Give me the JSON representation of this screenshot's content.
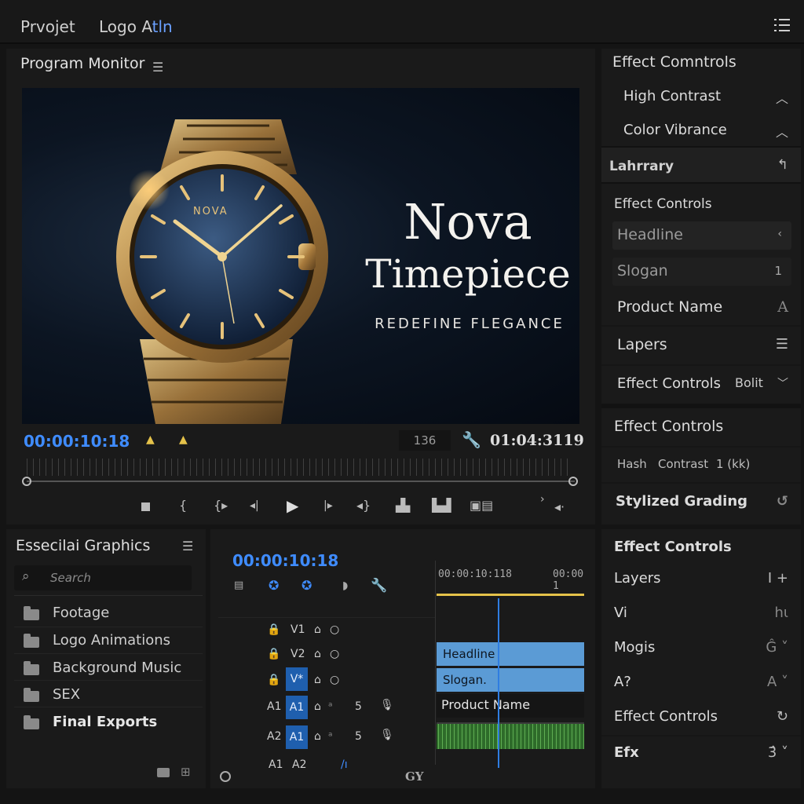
{
  "topbar": {
    "menu_1": "Prvojet",
    "menu_2_a": "Logo A",
    "menu_2_b": "tln"
  },
  "program": {
    "title": "Program Monitor",
    "viewer": {
      "headline_1": "Nova",
      "headline_2": "Timepiece",
      "tagline": "REDEFINE FLEGANCE",
      "dial_brand": "NOVA"
    },
    "timecode_left": "00:00:10:18",
    "zoom_value": "136",
    "timecode_right": "01:04:3119"
  },
  "effects_panel": {
    "header": "Effect Comntrols",
    "items": [
      "High Contrast",
      "Color Vibrance"
    ],
    "library_label": "Lahrrary",
    "section_label": "Effect Controls",
    "fields": [
      {
        "label": "Headline",
        "value": "‹"
      },
      {
        "label": "Slogan",
        "value": "1"
      },
      {
        "label": "Product Name",
        "value": "A"
      }
    ],
    "layers_label": "Lapers",
    "effect_controls_2": "Effect Controls",
    "effect_controls_2_value": "Bolit",
    "effect_controls_3": "Effect Controls",
    "hash_row": {
      "a": "Hash",
      "b": "Contrast",
      "c": "1 (kk)"
    },
    "stylized": "Stylized Grading"
  },
  "essential": {
    "title": "Essecilai Graphics",
    "search_placeholder": "Search",
    "folders": [
      "Footage",
      "Logo  Animations",
      "Background Music",
      "SEX",
      "Final Exports"
    ]
  },
  "timeline": {
    "timecode": "00:00:10:18",
    "ruler_1": "00:00:10:118",
    "ruler_2": "00:00 1",
    "tracks": [
      {
        "label": "V1"
      },
      {
        "label": "V2"
      },
      {
        "label": "V*"
      },
      {
        "src": "A1",
        "label": "A1",
        "num": "5"
      },
      {
        "src": "A2",
        "label": "A1",
        "num": "5"
      },
      {
        "src": "A1",
        "label": "A2"
      }
    ],
    "clips": {
      "headline": "Headline",
      "slogan": "Slogan.",
      "product": "Product Name"
    },
    "footer": "GY"
  },
  "effects_bottom": {
    "header": "Effect Controls",
    "rows": [
      {
        "label": "Layers",
        "value": "Ι +"
      },
      {
        "label": "Vi",
        "value": "hι"
      },
      {
        "label": "Mogis",
        "value": "Ĝ ˅"
      },
      {
        "label": "A?",
        "value": "A ˅"
      },
      {
        "label": "Effect Controls",
        "value": "↻"
      },
      {
        "label": "Efx",
        "value": "3̂ ˅"
      }
    ]
  },
  "colors": {
    "accent": "#3f8cff",
    "clip": "#5b9bd5",
    "playhead": "#2f7de1",
    "marker": "#e5c24a"
  }
}
